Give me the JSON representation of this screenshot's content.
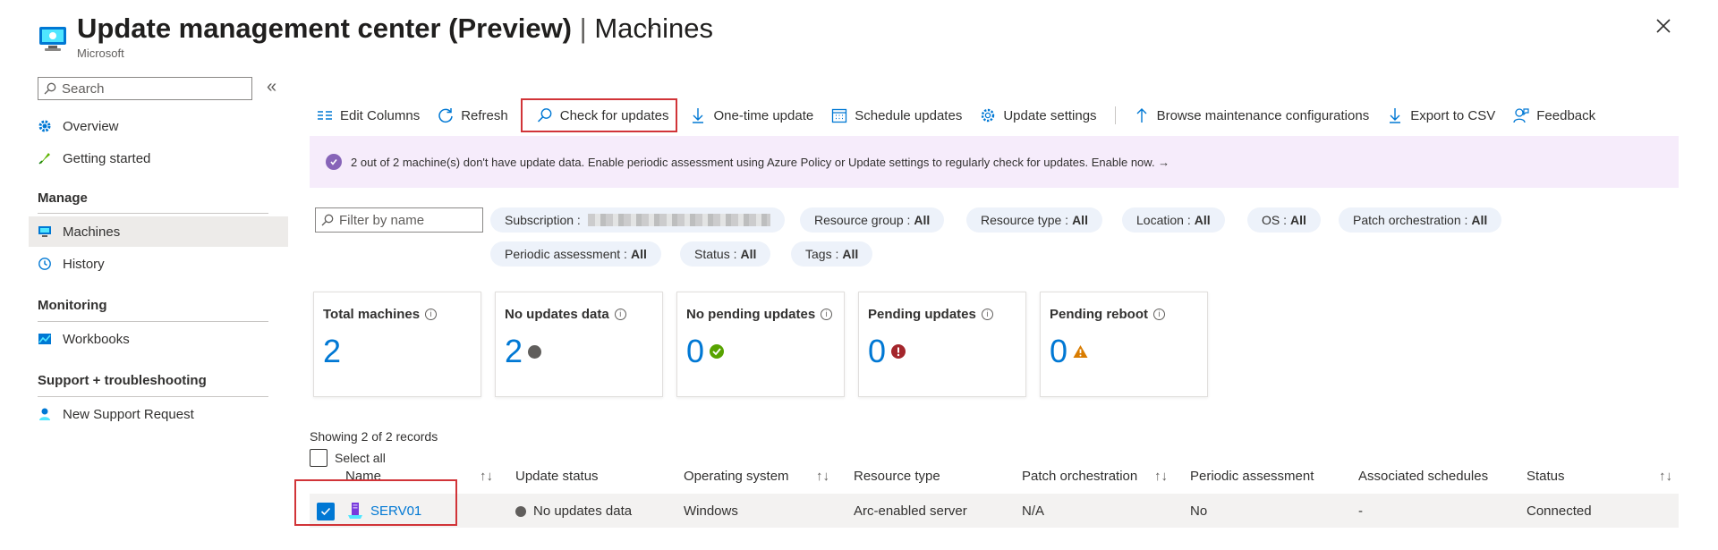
{
  "header": {
    "title": "Update management center (Preview)",
    "title_separator": "|",
    "page": "Machines",
    "subtitle": "Microsoft",
    "more_label": "···"
  },
  "sidebar": {
    "search_placeholder": "Search",
    "collapse_label": "«",
    "items": [
      {
        "label": "Overview",
        "icon": "gear-icon"
      },
      {
        "label": "Getting started",
        "icon": "rocket-icon"
      }
    ],
    "sections": [
      {
        "title": "Manage",
        "items": [
          {
            "label": "Machines",
            "icon": "monitor-icon",
            "active": true
          },
          {
            "label": "History",
            "icon": "clock-icon"
          }
        ]
      },
      {
        "title": "Monitoring",
        "items": [
          {
            "label": "Workbooks",
            "icon": "workbook-icon"
          }
        ]
      },
      {
        "title": "Support + troubleshooting",
        "items": [
          {
            "label": "New Support Request",
            "icon": "person-support-icon"
          }
        ]
      }
    ]
  },
  "toolbar": {
    "edit_columns": "Edit Columns",
    "refresh": "Refresh",
    "check_for_updates": "Check for updates",
    "one_time_update": "One-time update",
    "schedule_updates": "Schedule updates",
    "update_settings": "Update settings",
    "browse_maintenance": "Browse maintenance configurations",
    "export_csv": "Export to CSV",
    "feedback": "Feedback"
  },
  "banner": {
    "text": "2 out of 2 machine(s) don't have update data. Enable periodic assessment using Azure Policy or Update settings to regularly check for updates. Enable now. →"
  },
  "filters": {
    "name_placeholder": "Filter by name",
    "pills": [
      {
        "label": "Subscription :",
        "value": ""
      },
      {
        "label": "Resource group :",
        "value": "All"
      },
      {
        "label": "Resource type :",
        "value": "All"
      },
      {
        "label": "Location :",
        "value": "All"
      },
      {
        "label": "OS :",
        "value": "All"
      },
      {
        "label": "Patch orchestration :",
        "value": "All"
      },
      {
        "label": "Periodic assessment :",
        "value": "All"
      },
      {
        "label": "Status :",
        "value": "All"
      },
      {
        "label": "Tags :",
        "value": "All"
      }
    ]
  },
  "cards": [
    {
      "title": "Total machines",
      "value": "2",
      "status": "none"
    },
    {
      "title": "No updates data",
      "value": "2",
      "status": "gray"
    },
    {
      "title": "No pending updates",
      "value": "0",
      "status": "green-check"
    },
    {
      "title": "Pending updates",
      "value": "0",
      "status": "red-alert"
    },
    {
      "title": "Pending reboot",
      "value": "0",
      "status": "orange-warning"
    }
  ],
  "colors": {
    "accent": "#0078d4",
    "highlight": "#d13438",
    "banner_bg": "#f6ecfb",
    "pill_bg": "#edf2fa"
  },
  "table": {
    "records_text": "Showing 2 of 2 records",
    "select_all": "Select all",
    "columns": [
      "Name",
      "Update status",
      "Operating system",
      "Resource type",
      "Patch orchestration",
      "Periodic assessment",
      "Associated schedules",
      "Status"
    ],
    "sort_glyph": "↑↓",
    "rows": [
      {
        "name": "SERV01",
        "update_status": "No updates data",
        "os": "Windows",
        "resource_type": "Arc-enabled server",
        "patch_orchestration": "N/A",
        "periodic_assessment": "No",
        "associated_schedules": "-",
        "status": "Connected",
        "selected": true
      }
    ]
  }
}
